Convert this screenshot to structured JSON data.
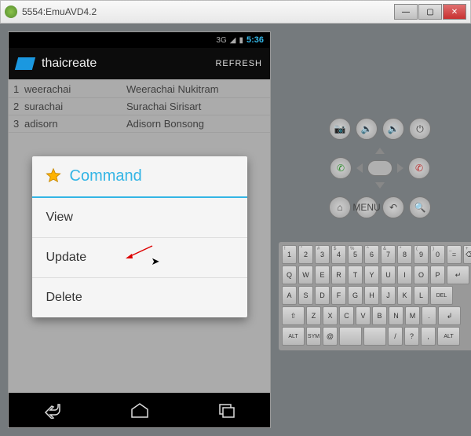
{
  "window": {
    "title": "5554:EmuAVD4.2",
    "min": "—",
    "max": "▢",
    "close": "✕"
  },
  "status": {
    "net": "3G",
    "signal": "◢",
    "battery": "▮",
    "time": "5:36"
  },
  "actionbar": {
    "title": "thaicreate",
    "refresh": "REFRESH"
  },
  "list": [
    {
      "n": "1",
      "user": "weerachai",
      "name": "Weerachai Nukitram"
    },
    {
      "n": "2",
      "user": "surachai",
      "name": "Surachai Sirisart"
    },
    {
      "n": "3",
      "user": "adisorn",
      "name": "Adisorn Bonsong"
    }
  ],
  "dialog": {
    "title": "Command",
    "items": [
      "View",
      "Update",
      "Delete"
    ]
  },
  "hw": {
    "camera": "📷",
    "vol_down": "🔉",
    "vol_up": "🔊",
    "power": "⏻",
    "call": "✆",
    "end": "✆",
    "home": "⌂",
    "menu": "MENU",
    "back": "↶",
    "search": "🔍"
  },
  "keyboard": {
    "row1_sup": [
      "!",
      "\"",
      "#",
      "$",
      "%",
      "^",
      "&",
      "*",
      "(",
      ")",
      "_",
      "+"
    ],
    "row1": [
      "1",
      "2",
      "3",
      "4",
      "5",
      "6",
      "7",
      "8",
      "9",
      "0",
      "=",
      "⌫"
    ],
    "row2": [
      "Q",
      "W",
      "E",
      "R",
      "T",
      "Y",
      "U",
      "I",
      "O",
      "P",
      "↵"
    ],
    "row3": [
      "A",
      "S",
      "D",
      "F",
      "G",
      "H",
      "J",
      "K",
      "L",
      "DEL"
    ],
    "row4": [
      "⇧",
      "Z",
      "X",
      "C",
      "V",
      "B",
      "N",
      "M",
      ".",
      "↲"
    ],
    "row5": [
      "ALT",
      "SYM",
      "@",
      "",
      "",
      "/",
      "?",
      ",",
      "ALT"
    ]
  }
}
